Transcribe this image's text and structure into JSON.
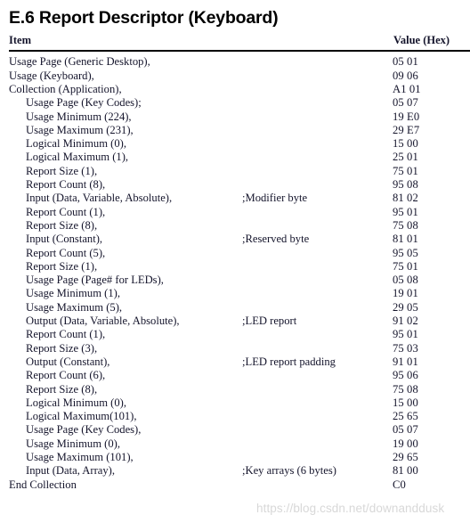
{
  "document": {
    "title": "E.6 Report Descriptor (Keyboard)",
    "watermark": "https://blog.csdn.net/downanddusk"
  },
  "table": {
    "headers": {
      "item": "Item",
      "comment": "",
      "value": "Value (Hex)"
    },
    "rows": [
      {
        "indent": 0,
        "item": "Usage Page (Generic Desktop),",
        "comment": "",
        "value": "05 01"
      },
      {
        "indent": 0,
        "item": "Usage (Keyboard),",
        "comment": "",
        "value": "09 06"
      },
      {
        "indent": 0,
        "item": "Collection (Application),",
        "comment": "",
        "value": "A1 01"
      },
      {
        "indent": 1,
        "item": "Usage Page (Key Codes);",
        "comment": "",
        "value": "05 07"
      },
      {
        "indent": 1,
        "item": "Usage Minimum (224),",
        "comment": "",
        "value": "19 E0"
      },
      {
        "indent": 1,
        "item": "Usage Maximum (231),",
        "comment": "",
        "value": "29 E7"
      },
      {
        "indent": 1,
        "item": "Logical Minimum (0),",
        "comment": "",
        "value": "15 00"
      },
      {
        "indent": 1,
        "item": "Logical Maximum (1),",
        "comment": "",
        "value": "25 01"
      },
      {
        "indent": 1,
        "item": "Report Size (1),",
        "comment": "",
        "value": "75 01"
      },
      {
        "indent": 1,
        "item": "Report Count (8),",
        "comment": "",
        "value": "95 08"
      },
      {
        "indent": 1,
        "item": "Input (Data, Variable, Absolute),",
        "comment": ";Modifier byte",
        "value": "81 02"
      },
      {
        "indent": 1,
        "item": "Report Count (1),",
        "comment": "",
        "value": "95 01"
      },
      {
        "indent": 1,
        "item": "Report Size (8),",
        "comment": "",
        "value": "75 08"
      },
      {
        "indent": 1,
        "item": "Input (Constant),",
        "comment": ";Reserved byte",
        "value": "81 01"
      },
      {
        "indent": 1,
        "item": "Report Count (5),",
        "comment": "",
        "value": "95 05"
      },
      {
        "indent": 1,
        "item": "Report Size (1),",
        "comment": "",
        "value": "75 01"
      },
      {
        "indent": 1,
        "item": "Usage Page (Page# for LEDs),",
        "comment": "",
        "value": "05 08"
      },
      {
        "indent": 1,
        "item": "Usage Minimum (1),",
        "comment": "",
        "value": "19 01"
      },
      {
        "indent": 1,
        "item": "Usage Maximum (5),",
        "comment": "",
        "value": "29 05"
      },
      {
        "indent": 1,
        "item": "Output (Data, Variable, Absolute),",
        "comment": ";LED report",
        "value": "91 02"
      },
      {
        "indent": 1,
        "item": "Report Count (1),",
        "comment": "",
        "value": "95 01"
      },
      {
        "indent": 1,
        "item": "Report Size (3),",
        "comment": "",
        "value": "75 03"
      },
      {
        "indent": 1,
        "item": "Output (Constant),",
        "comment": ";LED report padding",
        "value": "91 01"
      },
      {
        "indent": 1,
        "item": "Report Count (6),",
        "comment": "",
        "value": "95 06"
      },
      {
        "indent": 1,
        "item": "Report Size (8),",
        "comment": "",
        "value": "75 08"
      },
      {
        "indent": 1,
        "item": "Logical Minimum (0),",
        "comment": "",
        "value": "15 00"
      },
      {
        "indent": 1,
        "item": "Logical Maximum(101),",
        "comment": "",
        "value": "25 65"
      },
      {
        "indent": 1,
        "item": "Usage Page (Key Codes),",
        "comment": "",
        "value": "05 07"
      },
      {
        "indent": 1,
        "item": "Usage Minimum (0),",
        "comment": "",
        "value": "19 00"
      },
      {
        "indent": 1,
        "item": "Usage Maximum (101),",
        "comment": "",
        "value": "29 65"
      },
      {
        "indent": 1,
        "item": "Input (Data, Array),",
        "comment": ";Key arrays (6 bytes)",
        "value": "81 00"
      },
      {
        "indent": 0,
        "item": "End Collection",
        "comment": "",
        "value": "C0"
      }
    ]
  }
}
